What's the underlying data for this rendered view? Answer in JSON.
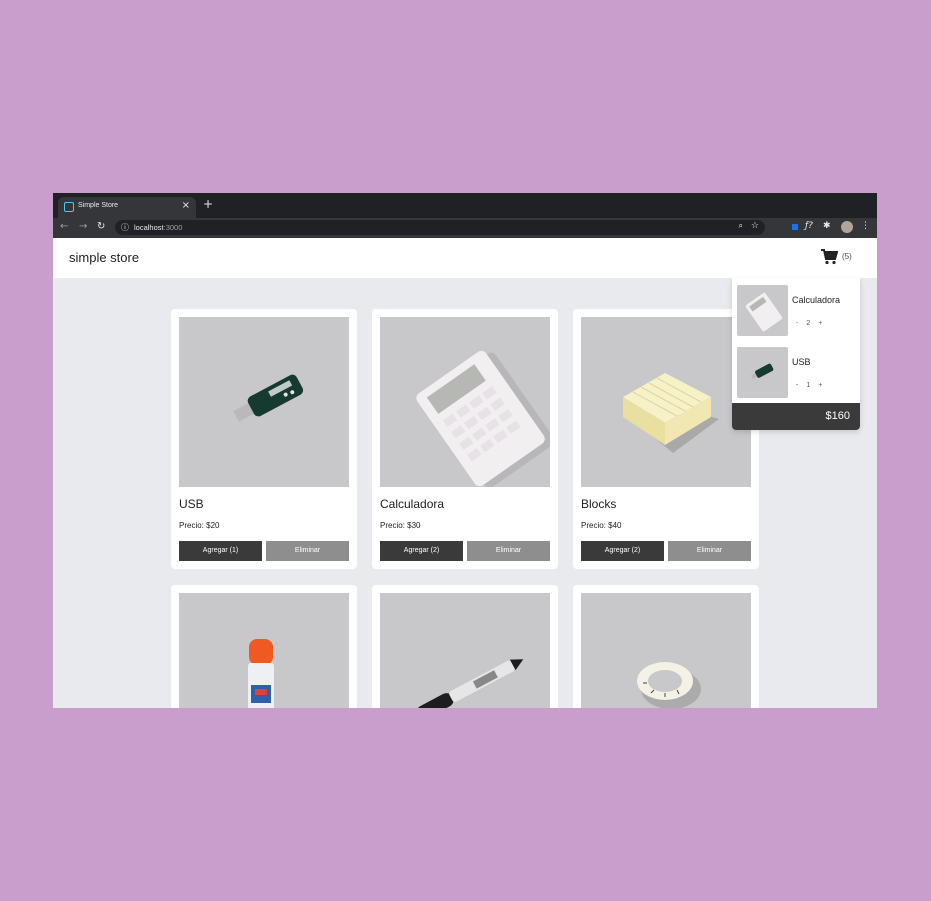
{
  "browser": {
    "tab_title": "Simple Store",
    "tab_close": "×",
    "new_tab": "+",
    "url_host": "localhost",
    "url_port": ":3000"
  },
  "store": {
    "brand": "simple store",
    "cart_count": "(5)"
  },
  "products": [
    {
      "name": "USB",
      "price": "Precio: $20",
      "add_label": "Agregar (1)",
      "remove_label": "Eliminar"
    },
    {
      "name": "Calculadora",
      "price": "Precio: $30",
      "add_label": "Agregar (2)",
      "remove_label": "Eliminar"
    },
    {
      "name": "Blocks",
      "price": "Precio: $40",
      "add_label": "Agregar (2)",
      "remove_label": "Eliminar"
    }
  ],
  "cart": {
    "items": [
      {
        "name": "Calculadora",
        "minus": "-",
        "qty": "2",
        "plus": "+"
      },
      {
        "name": "USB",
        "minus": "-",
        "qty": "1",
        "plus": "+"
      }
    ],
    "total": "$160"
  },
  "colors": {
    "background": "#c99ecc",
    "button_dark": "#3a3a3a",
    "button_gray": "#8e8e8e"
  }
}
